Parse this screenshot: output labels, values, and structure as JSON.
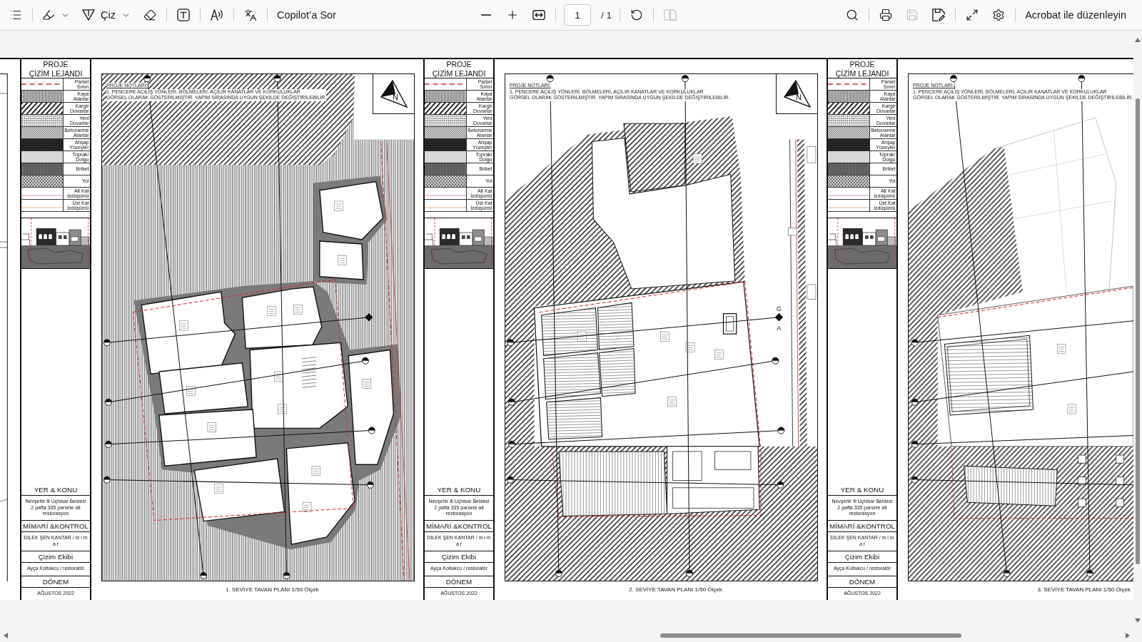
{
  "toolbar": {
    "left": [
      [
        {
          "kind": "contents",
          "disabled": false
        }
      ],
      [
        {
          "kind": "highlight",
          "disabled": false
        },
        {
          "kind": "draw",
          "label": "Çiz",
          "disabled": false
        },
        {
          "kind": "erase",
          "disabled": false
        }
      ],
      [
        {
          "kind": "text-box",
          "disabled": false
        }
      ],
      [
        {
          "kind": "read-aloud",
          "disabled": false
        }
      ],
      [
        {
          "kind": "translate",
          "disabled": false
        }
      ],
      [
        {
          "kind": "copilot",
          "label": "Copilot’a Sor",
          "disabled": false
        }
      ]
    ],
    "center": [
      [
        {
          "kind": "zoom-out",
          "disabled": false
        },
        {
          "kind": "zoom-in",
          "disabled": false
        },
        {
          "kind": "fit-width",
          "disabled": false
        }
      ],
      [
        {
          "kind": "page",
          "value": "1",
          "total": "/ 1"
        }
      ],
      [
        {
          "kind": "rotate",
          "disabled": false
        }
      ],
      [
        {
          "kind": "two-page",
          "disabled": true
        }
      ]
    ],
    "right": [
      [
        {
          "kind": "search",
          "disabled": false
        }
      ],
      [
        {
          "kind": "print",
          "disabled": false
        },
        {
          "kind": "save",
          "disabled": true
        },
        {
          "kind": "save-as",
          "disabled": false
        }
      ],
      [
        {
          "kind": "fullscreen",
          "disabled": false
        },
        {
          "kind": "settings",
          "disabled": false
        }
      ],
      [
        {
          "kind": "edit-in-acrobat",
          "label": "Acrobat ile düzenleyin",
          "disabled": false
        }
      ]
    ]
  },
  "document": {
    "panels": [
      {
        "legend": {
          "title_lines": [
            "PROJE",
            "ÇİZİM LEJANDI"
          ],
          "items": [
            {
              "kind": "parcel",
              "label": "Parsel Sınırı"
            },
            {
              "kind": "rock",
              "label": "Kaya Alanlar"
            },
            {
              "kind": "masonry",
              "label": "Kargir Duvarlar"
            },
            {
              "kind": "new-wall",
              "label": "Yeni Duvarlar"
            },
            {
              "kind": "concrete",
              "label": "Betonarme Alanlar"
            },
            {
              "kind": "timber",
              "label": "Ahşap Yüzeyler"
            },
            {
              "kind": "fill",
              "label": "Toprak/ Dolgu"
            },
            {
              "kind": "briquette",
              "label": "Briket"
            },
            {
              "kind": "road",
              "label": "Yol"
            },
            {
              "kind": "lower-floor",
              "label": "Alt Kat İzdüşümü"
            },
            {
              "kind": "upper-floor",
              "label": "Üst Kat İzdüşümü"
            }
          ]
        },
        "title_block": [
          {
            "kind": "heading",
            "lines": [
              "YER & KONU"
            ]
          },
          {
            "kind": "detail",
            "lines": [
              "Nevşehir ili Uçhisar Beldesi",
              "2 pafta 335 parsele ait",
              "restorasyon"
            ]
          },
          {
            "kind": "heading",
            "lines": [
              "MİMARİ &KONTROL"
            ]
          },
          {
            "kind": "detail",
            "lines": [
              "DİLEK ŞEN KANTAR / m i m a r"
            ]
          },
          {
            "kind": "heading",
            "lines": [
              "Çizim Ekibi"
            ]
          },
          {
            "kind": "detail",
            "lines": [
              "Ayça Koltukcu / restoratör"
            ]
          },
          {
            "kind": "heading",
            "lines": [
              "DÖNEM"
            ]
          },
          {
            "kind": "detail",
            "lines": [
              "AĞUSTOS 2022"
            ]
          }
        ],
        "plan": {
          "kind": "level-1",
          "notes_title": "PROJE NOTLARI:",
          "notes": [
            "1. PENCERE AÇILIŞ YÖNLERİ, BÖLMELERİ, AÇILIR KANATLAR VE KORKULUKLAR",
            "GÖRSEL OLARAK GÖSTERİLMİŞTİR. YAPIM SIRASINDA UYGUN ŞEKİLDE DEĞİŞTİRİLEBİLİR."
          ],
          "north_label": "N"
        },
        "caption": "1. SEVİYE TAVAN PLANI 1/50  Ölçek"
      },
      {
        "legend": {
          "title_lines": [
            "PROJE",
            "ÇİZİM LEJANDI"
          ],
          "items": [
            {
              "kind": "parcel",
              "label": "Parsel Sınırı"
            },
            {
              "kind": "rock",
              "label": "Kaya Alanlar"
            },
            {
              "kind": "masonry",
              "label": "Kargir Duvarlar"
            },
            {
              "kind": "new-wall",
              "label": "Yeni Duvarlar"
            },
            {
              "kind": "concrete",
              "label": "Betonarme Alanlar"
            },
            {
              "kind": "timber",
              "label": "Ahşap Yüzeyler"
            },
            {
              "kind": "fill",
              "label": "Toprak/ Dolgu"
            },
            {
              "kind": "briquette",
              "label": "Briket"
            },
            {
              "kind": "road",
              "label": "Yol"
            },
            {
              "kind": "lower-floor",
              "label": "Alt Kat İzdüşümü"
            },
            {
              "kind": "upper-floor",
              "label": "Üst Kat İzdüşümü"
            }
          ]
        },
        "title_block": [
          {
            "kind": "heading",
            "lines": [
              "YER & KONU"
            ]
          },
          {
            "kind": "detail",
            "lines": [
              "Nevşehir ili Uçhisar Beldesi",
              "2 pafta 335 parsele ait",
              "restorasyon"
            ]
          },
          {
            "kind": "heading",
            "lines": [
              "MİMARİ &KONTROL"
            ]
          },
          {
            "kind": "detail",
            "lines": [
              "DİLEK ŞEN KANTAR / m i m a r"
            ]
          },
          {
            "kind": "heading",
            "lines": [
              "Çizim Ekibi"
            ]
          },
          {
            "kind": "detail",
            "lines": [
              "Ayça Koltukcu / restoratör"
            ]
          },
          {
            "kind": "heading",
            "lines": [
              "DÖNEM"
            ]
          },
          {
            "kind": "detail",
            "lines": [
              "AĞUSTOS 2022"
            ]
          }
        ],
        "plan": {
          "kind": "level-2",
          "notes_title": "PROJE NOTLARI:",
          "notes": [
            "1. PENCERE AÇILIŞ YÖNLERİ, BÖLMELERİ, AÇILIR KANATLAR VE KORKULUKLAR",
            "GÖRSEL OLARAK GÖSTERİLMİŞTİR. YAPIM SIRASINDA UYGUN ŞEKİLDE DEĞİŞTİRİLEBİLİR."
          ],
          "north_label": "N",
          "section_marks": [
            "G",
            "A"
          ]
        },
        "caption": "2. SEVİYE TAVAN PLANI 1/50  Ölçek"
      },
      {
        "legend": {
          "title_lines": [
            "PROJE",
            "ÇİZİM LEJANDI"
          ],
          "items": [
            {
              "kind": "parcel",
              "label": "Parsel Sınırı"
            },
            {
              "kind": "rock",
              "label": "Kaya Alanlar"
            },
            {
              "kind": "masonry",
              "label": "Kargir Duvarlar"
            },
            {
              "kind": "new-wall",
              "label": "Yeni Duvarlar"
            },
            {
              "kind": "concrete",
              "label": "Betonarme Alanlar"
            },
            {
              "kind": "timber",
              "label": "Ahşap Yüzeyler"
            },
            {
              "kind": "fill",
              "label": "Toprak/ Dolgu"
            },
            {
              "kind": "briquette",
              "label": "Briket"
            },
            {
              "kind": "road",
              "label": "Yol"
            },
            {
              "kind": "lower-floor",
              "label": "Alt Kat İzdüşümü"
            },
            {
              "kind": "upper-floor",
              "label": "Üst Kat İzdüşümü"
            }
          ]
        },
        "title_block": [
          {
            "kind": "heading",
            "lines": [
              "YER & KONU"
            ]
          },
          {
            "kind": "detail",
            "lines": [
              "Nevşehir ili Uçhisar Beldesi",
              "2 pafta 335 parsele ait",
              "restorasyon"
            ]
          },
          {
            "kind": "heading",
            "lines": [
              "MİMARİ &KONTROL"
            ]
          },
          {
            "kind": "detail",
            "lines": [
              "DİLEK ŞEN KANTAR / m i m a r"
            ]
          },
          {
            "kind": "heading",
            "lines": [
              "Çizim Ekibi"
            ]
          },
          {
            "kind": "detail",
            "lines": [
              "Ayça Koltukcu / restoratör"
            ]
          },
          {
            "kind": "heading",
            "lines": [
              "DÖNEM"
            ]
          },
          {
            "kind": "detail",
            "lines": [
              "AĞUSTOS 2022"
            ]
          }
        ],
        "plan": {
          "kind": "level-3",
          "notes_title": "PROJE NOTLARI:",
          "notes": [
            "1. PENCERE AÇILIŞ YÖNLERİ, BÖLMELERİ, AÇILIR KANATLAR VE KORKULUKLAR",
            "GÖRSEL OLARAK GÖSTERİLMİŞTİR. YAPIM SIRASINDA UYGUN ŞEKİLDE DEĞİŞTİRİLEBİLİR."
          ]
        },
        "caption": "3. SEVİYE TAVAN PLANI 1/50  Ölçek"
      }
    ]
  }
}
